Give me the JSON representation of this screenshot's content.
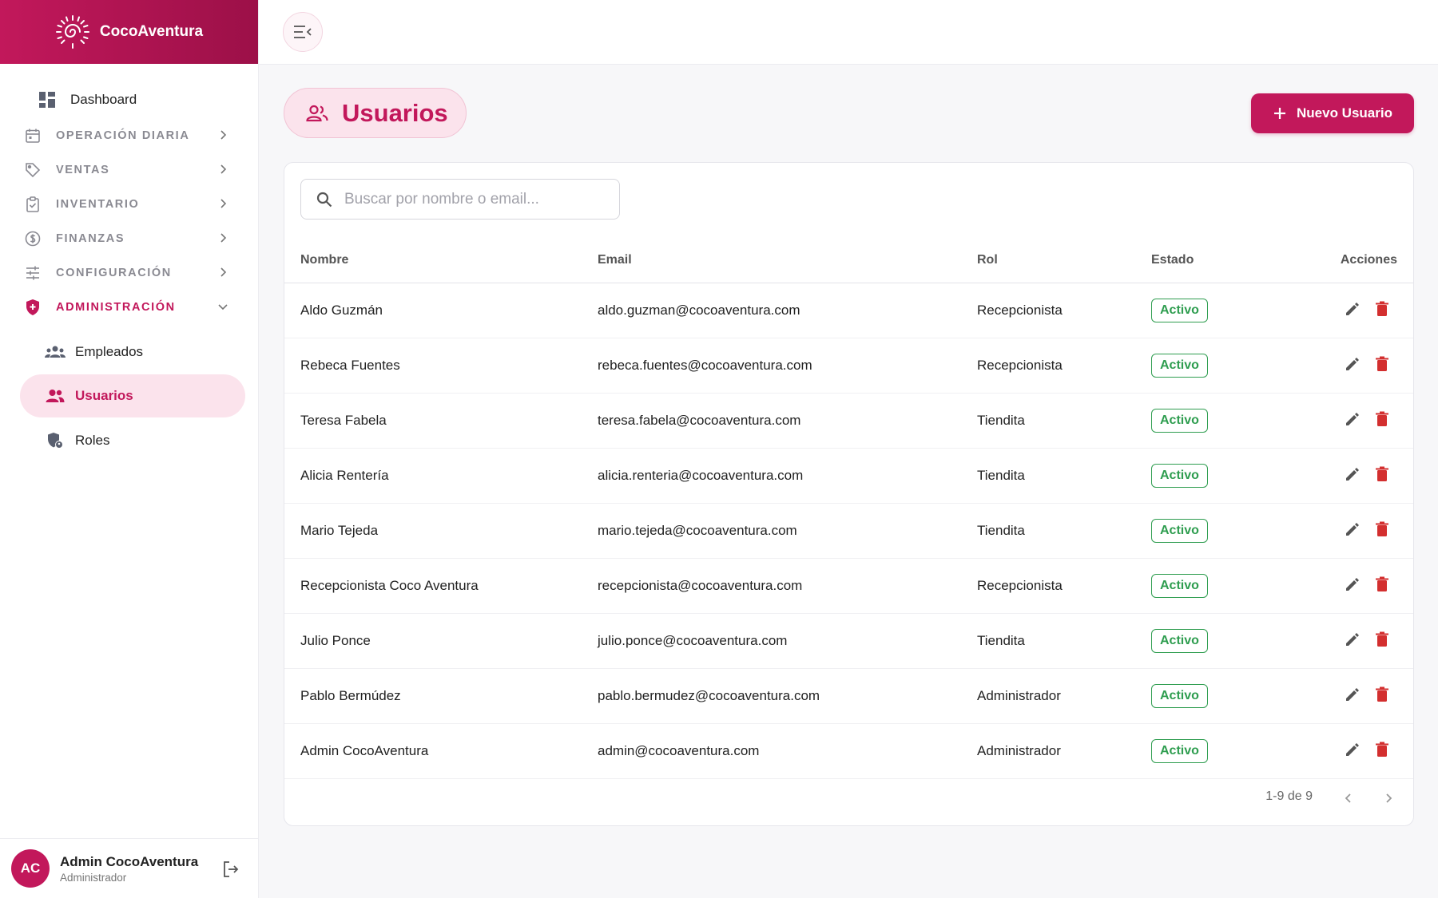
{
  "app": {
    "name": "CocoAventura"
  },
  "sidebar": {
    "dashboard": "Dashboard",
    "sections": [
      {
        "label": "OPERACIÓN DIARIA"
      },
      {
        "label": "VENTAS"
      },
      {
        "label": "INVENTARIO"
      },
      {
        "label": "FINANZAS"
      },
      {
        "label": "CONFIGURACIÓN"
      },
      {
        "label": "ADMINISTRACIÓN"
      }
    ],
    "subitems": [
      {
        "label": "Empleados"
      },
      {
        "label": "Usuarios"
      },
      {
        "label": "Roles"
      }
    ]
  },
  "user": {
    "initials": "AC",
    "name": "Admin CocoAventura",
    "role": "Administrador"
  },
  "page": {
    "title": "Usuarios",
    "new_button": "Nuevo Usuario"
  },
  "search": {
    "placeholder": "Buscar por nombre o email..."
  },
  "table": {
    "headers": [
      "Nombre",
      "Email",
      "Rol",
      "Estado",
      "Acciones"
    ],
    "rows": [
      {
        "name": "Aldo Guzmán",
        "email": "aldo.guzman@cocoaventura.com",
        "role": "Recepcionista",
        "status": "Activo"
      },
      {
        "name": "Rebeca Fuentes",
        "email": "rebeca.fuentes@cocoaventura.com",
        "role": "Recepcionista",
        "status": "Activo"
      },
      {
        "name": "Teresa Fabela",
        "email": "teresa.fabela@cocoaventura.com",
        "role": "Tiendita",
        "status": "Activo"
      },
      {
        "name": "Alicia Rentería",
        "email": "alicia.renteria@cocoaventura.com",
        "role": "Tiendita",
        "status": "Activo"
      },
      {
        "name": "Mario Tejeda",
        "email": "mario.tejeda@cocoaventura.com",
        "role": "Tiendita",
        "status": "Activo"
      },
      {
        "name": "Recepcionista Coco Aventura",
        "email": "recepcionista@cocoaventura.com",
        "role": "Recepcionista",
        "status": "Activo"
      },
      {
        "name": "Julio Ponce",
        "email": "julio.ponce@cocoaventura.com",
        "role": "Tiendita",
        "status": "Activo"
      },
      {
        "name": "Pablo Bermúdez",
        "email": "pablo.bermudez@cocoaventura.com",
        "role": "Administrador",
        "status": "Activo"
      },
      {
        "name": "Admin CocoAventura",
        "email": "admin@cocoaventura.com",
        "role": "Administrador",
        "status": "Activo"
      }
    ]
  },
  "pagination": {
    "text": "1-9 de 9"
  },
  "colors": {
    "brand": "#c2185b",
    "active_bg": "#fbe3ec",
    "status_active": "#2e9d4f",
    "delete": "#d32f2f"
  },
  "icons": {
    "logo": "spiral-sun-icon",
    "menu_toggle": "menu-collapse-icon",
    "dashboard": "dashboard-icon",
    "sections": [
      "calendar-icon",
      "tag-icon",
      "clipboard-icon",
      "dollar-icon",
      "sliders-icon",
      "shield-icon"
    ],
    "subitems": [
      "group-icon",
      "users-icon",
      "user-shield-icon"
    ],
    "search": "search-icon",
    "edit": "pencil-icon",
    "delete": "trash-icon",
    "logout": "logout-icon"
  }
}
